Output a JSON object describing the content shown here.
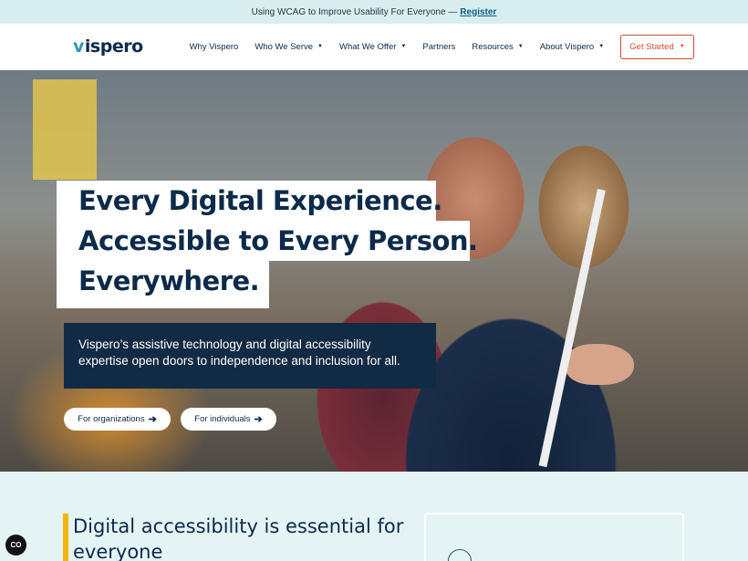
{
  "announcement": {
    "text": "Using WCAG to Improve Usability For Everyone —",
    "link": "Register"
  },
  "nav": {
    "logo_mark": "v",
    "logo_text": "ispero",
    "items": [
      {
        "label": "Why Vispero",
        "dropdown": false
      },
      {
        "label": "Who We Serve",
        "dropdown": true
      },
      {
        "label": "What We Offer",
        "dropdown": true
      },
      {
        "label": "Partners",
        "dropdown": false
      },
      {
        "label": "Resources",
        "dropdown": true
      },
      {
        "label": "About Vispero",
        "dropdown": true
      }
    ],
    "cta": "Get Started",
    "caret": "▼"
  },
  "hero": {
    "headline": [
      "Every Digital Experience.",
      "Accessible to Every Person.",
      "Everywhere."
    ],
    "subtext": "Vispero’s assistive technology and digital accessibility expertise open doors to independence and inclusion for all.",
    "buttons": [
      "For organizations",
      "For individuals"
    ],
    "arrow": "➔"
  },
  "section": {
    "heading": "Digital accessibility is essential for everyone"
  },
  "a11y_widget": "CO",
  "colors": {
    "accent": "#d34a2a",
    "navy": "#0d2a4a",
    "teal": "#2d9ea6",
    "banner": "#d9eef0",
    "yellow": "#f2b705"
  }
}
